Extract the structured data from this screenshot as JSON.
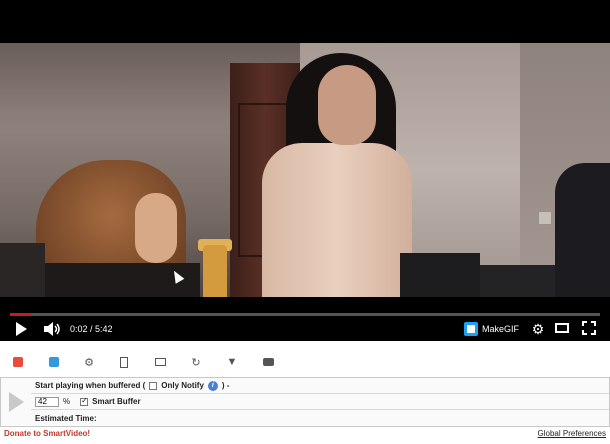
{
  "player": {
    "time_display": "0:02 / 5:42",
    "progress_fraction": 0.035,
    "makegif_label": "MakeGIF",
    "colors": {
      "progress": "#cc181e",
      "makegif_logo": "#1da1f2"
    }
  },
  "toolbar_icons": [
    "record-icon",
    "tag-icon",
    "gear-icon",
    "film-icon",
    "image-icon",
    "refresh-icon",
    "filter-icon",
    "camera-icon"
  ],
  "panel": {
    "start_playing_label": "Start playing when buffered (",
    "only_notify_label": "Only Notify",
    "info_glyph": "i",
    "trailing_text": ") -",
    "buffer_percent": "42",
    "percent_sign": "%",
    "smart_buffer_label": "Smart Buffer",
    "estimated_time_label": "Estimated Time:"
  },
  "footer": {
    "donate_label": "Donate to SmartVideo!",
    "global_preferences_label": "Global Preferences"
  }
}
